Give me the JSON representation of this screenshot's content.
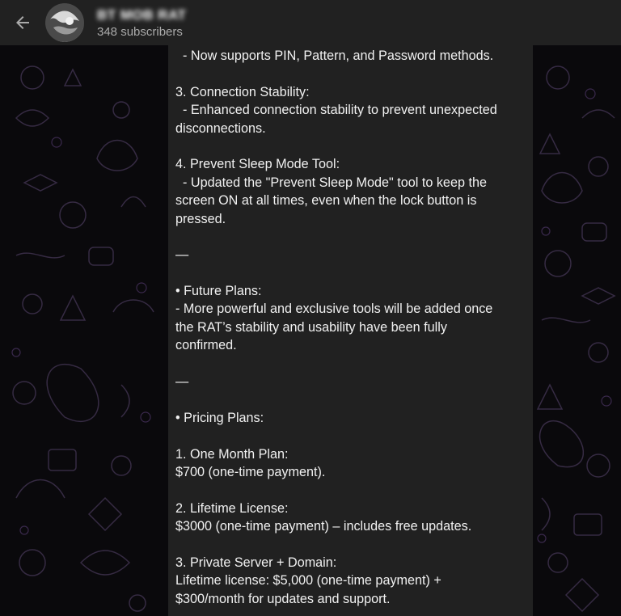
{
  "header": {
    "back_icon": "arrow-left-icon",
    "channel_name": "BT MOB RAT",
    "subscribers": "348 subscribers"
  },
  "message": {
    "lines": [
      "  - Now supports PIN, Pattern, and Password methods.",
      "",
      "3. Connection Stability:",
      "  - Enhanced connection stability to prevent unexpected",
      "disconnections.",
      "",
      "4. Prevent Sleep Mode Tool:",
      "  - Updated the \"Prevent Sleep Mode\" tool to keep the",
      "screen ON at all times, even when the lock button is",
      "pressed.",
      "",
      "—",
      "",
      "• Future Plans:",
      "- More powerful and exclusive tools will be added once",
      "the RAT’s stability and usability have been fully",
      "confirmed.",
      "",
      "—",
      "",
      "• Pricing Plans:",
      "",
      "1. One Month Plan:",
      "$700 (one-time payment).",
      "",
      "2. Lifetime License:",
      "$3000 (one-time payment) – includes free updates.",
      "",
      "3. Private Server + Domain:",
      "Lifetime license: $5,000 (one-time payment) +",
      "$300/month for updates and support."
    ]
  },
  "colors": {
    "header_bg": "#212121",
    "bubble_bg": "#212121",
    "doodle_color": "#4a3a5c"
  }
}
